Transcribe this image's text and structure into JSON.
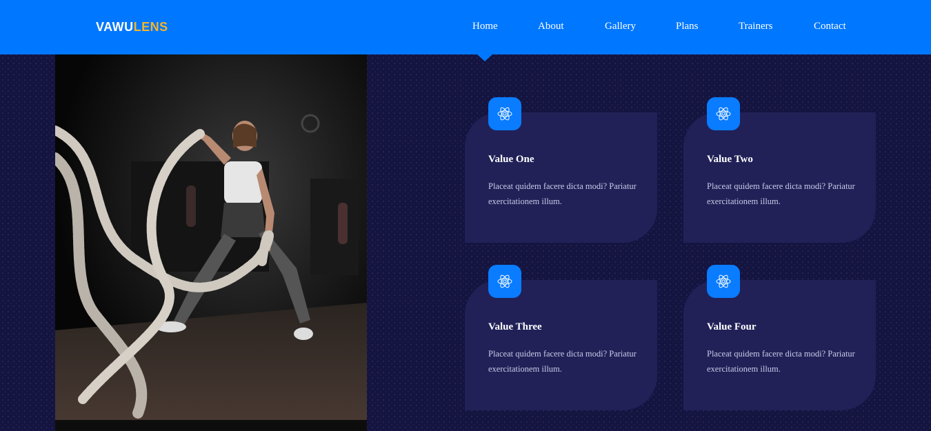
{
  "brand": {
    "name_part1": "VAWU",
    "name_part2": "LENS",
    "accent_color": "#f5b42a"
  },
  "nav": {
    "active": "Home",
    "items": [
      {
        "label": "Home"
      },
      {
        "label": "About"
      },
      {
        "label": "Gallery"
      },
      {
        "label": "Plans"
      },
      {
        "label": "Trainers"
      },
      {
        "label": "Contact"
      }
    ]
  },
  "hero_image": {
    "icon": "battle-ropes-athlete-photo"
  },
  "values": [
    {
      "title": "Value One",
      "text": "Placeat quidem facere dicta modi? Pariatur exercitationem illum.",
      "icon": "atom-icon"
    },
    {
      "title": "Value Two",
      "text": "Placeat quidem facere dicta modi? Pariatur exercitationem illum.",
      "icon": "atom-icon"
    },
    {
      "title": "Value Three",
      "text": "Placeat quidem facere dicta modi? Pariatur exercitationem illum.",
      "icon": "atom-icon"
    },
    {
      "title": "Value Four",
      "text": "Placeat quidem facere dicta modi? Pariatur exercitationem illum.",
      "icon": "atom-icon"
    }
  ],
  "colors": {
    "header": "#0077ff",
    "background": "#14143f",
    "card": "#212158",
    "icon_tile": "#0a7cff"
  }
}
